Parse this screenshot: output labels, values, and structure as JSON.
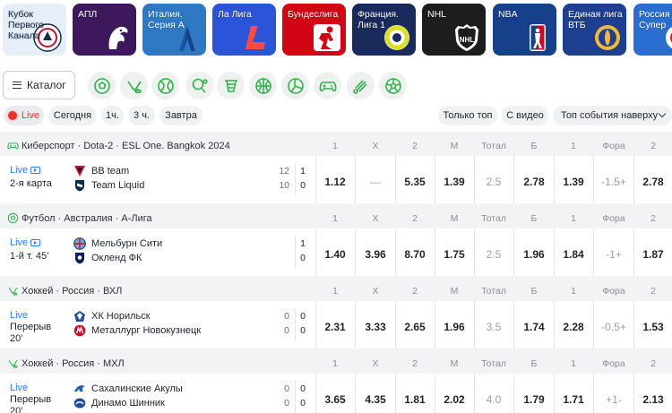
{
  "leagues": [
    {
      "label": "Кубок\nПервого\nКанала",
      "icon": "first-channel-cup-logo",
      "bg": "#e6eef7",
      "fg": "#1a2b4c"
    },
    {
      "label": "АПЛ",
      "icon": "premier-league-lion-logo",
      "bg": "#3d195b",
      "fg": "#ffffff"
    },
    {
      "label": "Италия.\nСерия А",
      "icon": "serie-a-logo",
      "bg": "#2f78c4",
      "fg": "#ffffff"
    },
    {
      "label": "Ла Лига",
      "icon": "la-liga-logo",
      "bg": "#2c54d9",
      "fg": "#ffffff"
    },
    {
      "label": "Бундеслига",
      "icon": "bundesliga-logo",
      "bg": "#d20515",
      "fg": "#ffffff"
    },
    {
      "label": "Франция.\nЛига 1",
      "icon": "ligue-1-logo",
      "bg": "#1a2a5a",
      "fg": "#ffffff"
    },
    {
      "label": "NHL",
      "icon": "nhl-logo",
      "bg": "#1d1d1f",
      "fg": "#ffffff"
    },
    {
      "label": "NBA",
      "icon": "nba-logo",
      "bg": "#17408b",
      "fg": "#ffffff"
    },
    {
      "label": "Единая лига\nВТБ",
      "icon": "vtb-league-logo",
      "bg": "#1e3f8f",
      "fg": "#ffffff"
    },
    {
      "label": "Россия\nСупер",
      "icon": "russia-superleague-logo",
      "bg": "#2a6fd0",
      "fg": "#ffffff"
    }
  ],
  "catalog": {
    "label": "Каталог"
  },
  "sports_icons": [
    "football-icon",
    "hockey-icon",
    "tennis-icon",
    "table-tennis-icon",
    "basketball-net-icon",
    "basketball-icon",
    "volleyball-icon",
    "esports-gamepad-icon",
    "badminton-icon",
    "futsal-icon"
  ],
  "filters": {
    "live": "Live",
    "today": "Сегодня",
    "h1": "1ч.",
    "h3": "3 ч.",
    "tomorrow": "Завтра",
    "only_top": "Только топ",
    "with_video": "С видео",
    "sort": "Топ события наверху"
  },
  "colors": {
    "accent_green": "#2fb34a",
    "live_red": "#e5342a",
    "link_blue": "#2e7cf6"
  },
  "events": [
    {
      "sport_icon": "esports-gamepad-icon",
      "title": "Киберспорт · Dota-2 · ESL One. Bangkok 2024",
      "cols": [
        "1",
        "X",
        "2",
        "М",
        "Тотал",
        "Б",
        "1",
        "Фора",
        "2"
      ],
      "live": "Live",
      "has_video": true,
      "period": "2-я карта",
      "team1": {
        "name": "BB team",
        "logo": "bb-team-logo",
        "sub_score": "12",
        "score": "1"
      },
      "team2": {
        "name": "Team Liquid",
        "logo": "team-liquid-logo",
        "sub_score": "10",
        "score": "0"
      },
      "odds": [
        "1.12",
        "—",
        "5.35",
        "1.39",
        "2.5",
        "2.78",
        "1.39",
        "-1.5+",
        "2.78"
      ]
    },
    {
      "sport_icon": "football-icon",
      "title": "Футбол · Австралия · А-Лига",
      "cols": [
        "1",
        "X",
        "2",
        "М",
        "Тотал",
        "Б",
        "1",
        "Фора",
        "2"
      ],
      "live": "Live",
      "has_video": true,
      "period": "1-й т. 45’",
      "team1": {
        "name": "Мельбурн Сити",
        "logo": "melbourne-city-logo",
        "sub_score": "",
        "score": "1"
      },
      "team2": {
        "name": "Окленд ФК",
        "logo": "auckland-fc-logo",
        "sub_score": "",
        "score": "0"
      },
      "odds": [
        "1.40",
        "3.96",
        "8.70",
        "1.75",
        "2.5",
        "1.96",
        "1.84",
        "-1+",
        "1.87"
      ]
    },
    {
      "sport_icon": "hockey-icon",
      "title": "Хоккей · Россия · ВХЛ",
      "cols": [
        "1",
        "X",
        "2",
        "М",
        "Тотал",
        "Б",
        "1",
        "Фора",
        "2"
      ],
      "live": "Live",
      "has_video": false,
      "period": "Перерыв\n20’",
      "team1": {
        "name": "ХК Норильск",
        "logo": "hc-norilsk-logo",
        "sub_score": "0",
        "score": "0"
      },
      "team2": {
        "name": "Металлург Новокузнецк",
        "logo": "metallurg-novokuznetsk-logo",
        "sub_score": "0",
        "score": "0"
      },
      "odds": [
        "2.31",
        "3.33",
        "2.65",
        "1.96",
        "3.5",
        "1.74",
        "2.28",
        "-0.5+",
        "1.53"
      ]
    },
    {
      "sport_icon": "hockey-icon",
      "title": "Хоккей · Россия · МХЛ",
      "cols": [
        "1",
        "X",
        "2",
        "М",
        "Тотал",
        "Б",
        "1",
        "Фора",
        "2"
      ],
      "live": "Live",
      "has_video": false,
      "period": "Перерыв\n20’",
      "team1": {
        "name": "Сахалинские Акулы",
        "logo": "sakhalin-sharks-logo",
        "sub_score": "0",
        "score": "0"
      },
      "team2": {
        "name": "Динамо Шинник",
        "logo": "dynamo-shinnik-logo",
        "sub_score": "0",
        "score": "0"
      },
      "odds": [
        "3.65",
        "4.35",
        "1.81",
        "2.02",
        "4.0",
        "1.79",
        "1.71",
        "+1-",
        "2.13"
      ]
    }
  ]
}
